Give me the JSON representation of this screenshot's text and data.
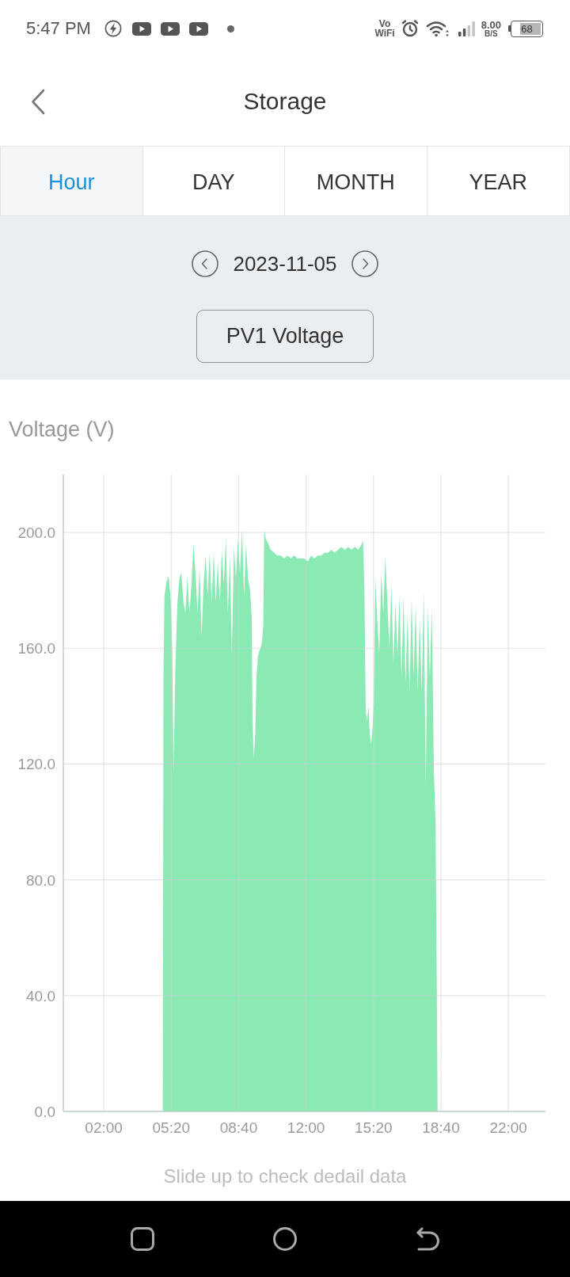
{
  "status_bar": {
    "time": "5:47 PM",
    "vowifi": {
      "line_1": "Vo",
      "line_2": "WiFi"
    },
    "network_speed": {
      "value": "8.00",
      "unit": "B/S"
    },
    "battery": "68"
  },
  "header": {
    "title": "Storage"
  },
  "tabs": [
    {
      "label": "Hour",
      "selected": true
    },
    {
      "label": "DAY",
      "selected": false
    },
    {
      "label": "MONTH",
      "selected": false
    },
    {
      "label": "YEAR",
      "selected": false
    }
  ],
  "date_nav": {
    "date": "2023-11-05"
  },
  "metric_button": {
    "label": "PV1 Voltage"
  },
  "chart": {
    "chart_data": {
      "type": "area",
      "ylabel": "Voltage (V)",
      "grid": true,
      "x": [
        0,
        295,
        297,
        300,
        306,
        312,
        318,
        323,
        327,
        332,
        338,
        344,
        350,
        356,
        362,
        368,
        374,
        380,
        386,
        392,
        398,
        404,
        410,
        416,
        422,
        428,
        434,
        440,
        446,
        452,
        458,
        464,
        470,
        476,
        482,
        488,
        494,
        500,
        506,
        512,
        518,
        524,
        530,
        536,
        542,
        548,
        554,
        559,
        561,
        565,
        569,
        573,
        577,
        581,
        585,
        589,
        593,
        596,
        600,
        604,
        608,
        615,
        625,
        635,
        645,
        655,
        665,
        675,
        685,
        695,
        705,
        715,
        725,
        735,
        745,
        755,
        765,
        775,
        785,
        795,
        805,
        815,
        825,
        835,
        845,
        855,
        865,
        875,
        885,
        889,
        893,
        897,
        901,
        905,
        909,
        913,
        917,
        921,
        925,
        931,
        937,
        943,
        949,
        955,
        961,
        967,
        973,
        979,
        985,
        991,
        997,
        1003,
        1009,
        1015,
        1021,
        1027,
        1033,
        1039,
        1045,
        1051,
        1057,
        1063,
        1069,
        1075,
        1081,
        1087,
        1093,
        1099,
        1104,
        1108,
        1110,
        1430
      ],
      "series": [
        {
          "color": "#8be9b4",
          "values": [
            0,
            0,
            150,
            178,
            183,
            185,
            178,
            160,
            117,
            152,
            175,
            184,
            186,
            176,
            172,
            185,
            172,
            182,
            196,
            186,
            172,
            188,
            164,
            182,
            192,
            178,
            193,
            176,
            193,
            176,
            190,
            176,
            194,
            182,
            198,
            172,
            192,
            158,
            195,
            184,
            198,
            186,
            201,
            178,
            196,
            184,
            180,
            170,
            135,
            122,
            130,
            150,
            157,
            159,
            160,
            162,
            168,
            201,
            198,
            197,
            196,
            194,
            193,
            192,
            192,
            191,
            192,
            191,
            192,
            191,
            191,
            191,
            190,
            192,
            191,
            192,
            192,
            193,
            193,
            194,
            193,
            194,
            195,
            194,
            195,
            194,
            195,
            194,
            196,
            197,
            180,
            138,
            135,
            140,
            130,
            127,
            132,
            140,
            185,
            170,
            158,
            186,
            172,
            192,
            176,
            160,
            182,
            155,
            176,
            158,
            178,
            150,
            178,
            148,
            172,
            145,
            177,
            150,
            175,
            145,
            170,
            145,
            180,
            113,
            174,
            150,
            174,
            118,
            100,
            40,
            0,
            0
          ]
        }
      ],
      "xlim": [
        0,
        1430
      ],
      "ylim": [
        0,
        220
      ],
      "xticks": [
        {
          "value": 120,
          "label": "02:00"
        },
        {
          "value": 320,
          "label": "05:20"
        },
        {
          "value": 520,
          "label": "08:40"
        },
        {
          "value": 720,
          "label": "12:00"
        },
        {
          "value": 920,
          "label": "15:20"
        },
        {
          "value": 1120,
          "label": "18:40"
        },
        {
          "value": 1320,
          "label": "22:00"
        }
      ],
      "yticks": [
        {
          "value": 0,
          "label": "0.0"
        },
        {
          "value": 40,
          "label": "40.0"
        },
        {
          "value": 80,
          "label": "80.0"
        },
        {
          "value": 120,
          "label": "120.0"
        },
        {
          "value": 160,
          "label": "160.0"
        },
        {
          "value": 200,
          "label": "200.0"
        }
      ]
    }
  },
  "hint": "Slide up to check dedail data"
}
